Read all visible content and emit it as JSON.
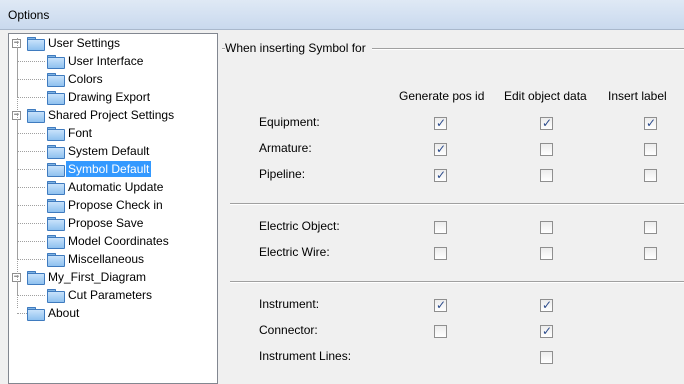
{
  "window": {
    "title": "Options"
  },
  "tree": {
    "items": [
      {
        "label": "User Settings",
        "level": 0,
        "expander": "−",
        "selected": false
      },
      {
        "label": "User Interface",
        "level": 1,
        "selected": false
      },
      {
        "label": "Colors",
        "level": 1,
        "selected": false
      },
      {
        "label": "Drawing Export",
        "level": 1,
        "selected": false
      },
      {
        "label": "Shared Project Settings",
        "level": 0,
        "expander": "−",
        "selected": false
      },
      {
        "label": "Font",
        "level": 1,
        "selected": false
      },
      {
        "label": "System Default",
        "level": 1,
        "selected": false
      },
      {
        "label": "Symbol Default",
        "level": 1,
        "selected": true
      },
      {
        "label": "Automatic Update",
        "level": 1,
        "selected": false
      },
      {
        "label": "Propose Check in",
        "level": 1,
        "selected": false
      },
      {
        "label": "Propose Save",
        "level": 1,
        "selected": false
      },
      {
        "label": "Model Coordinates",
        "level": 1,
        "selected": false
      },
      {
        "label": "Miscellaneous",
        "level": 1,
        "selected": false
      },
      {
        "label": "My_First_Diagram",
        "level": 0,
        "expander": "−",
        "selected": false
      },
      {
        "label": "Cut Parameters",
        "level": 1,
        "selected": false
      },
      {
        "label": "About",
        "level": 0,
        "selected": false
      }
    ]
  },
  "panel": {
    "section_title": "When inserting Symbol for",
    "columns": [
      "Generate pos id",
      "Edit object data",
      "Insert label"
    ],
    "groups": [
      {
        "rows": [
          {
            "label": "Equipment:",
            "checks": [
              true,
              true,
              true
            ]
          },
          {
            "label": "Armature:",
            "checks": [
              true,
              false,
              false
            ]
          },
          {
            "label": "Pipeline:",
            "checks": [
              true,
              false,
              false
            ]
          }
        ]
      },
      {
        "rows": [
          {
            "label": "Electric Object:",
            "checks": [
              false,
              false,
              false
            ]
          },
          {
            "label": "Electric Wire:",
            "checks": [
              false,
              false,
              false
            ]
          }
        ]
      },
      {
        "rows": [
          {
            "label": "Instrument:",
            "checks": [
              true,
              true,
              null
            ]
          },
          {
            "label": "Connector:",
            "checks": [
              false,
              true,
              null
            ]
          },
          {
            "label": "Instrument Lines:",
            "checks": [
              null,
              false,
              null
            ]
          }
        ]
      }
    ]
  }
}
